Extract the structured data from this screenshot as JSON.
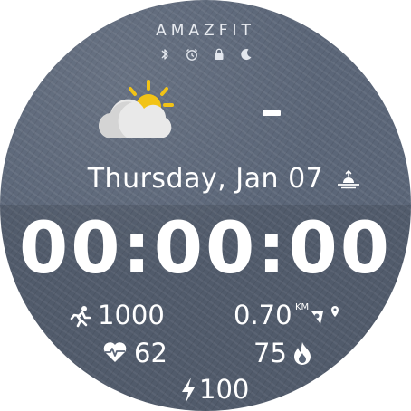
{
  "watch": {
    "brand": "AMAZFIT",
    "status_icons": [
      "bluetooth-icon",
      "alarm-icon",
      "lock-icon",
      "moon-icon"
    ],
    "weather": {
      "icon": "partly-cloudy-icon",
      "temperature": "-"
    },
    "date": "Thursday, Jan 07",
    "sunrise_icon": "sunrise-icon",
    "time": "00:00:00",
    "steps": "1000",
    "distance": "0.70",
    "distance_unit": "KM",
    "heart_rate": "62",
    "calories": "75",
    "battery": "100"
  },
  "colors": {
    "face": "#5b6678",
    "text": "#ffffff",
    "sun": "#f2c316",
    "cloud": "#e9e9e9"
  }
}
